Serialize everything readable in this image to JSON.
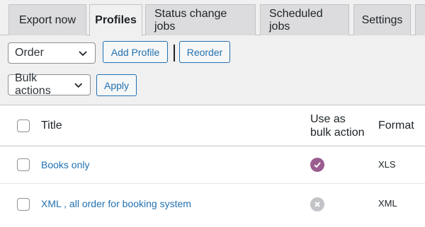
{
  "tabs": [
    {
      "label": "Export now",
      "active": false
    },
    {
      "label": "Profiles",
      "active": true
    },
    {
      "label": "Status change jobs",
      "active": false
    },
    {
      "label": "Scheduled jobs",
      "active": false
    },
    {
      "label": "Settings",
      "active": false
    }
  ],
  "toolbar": {
    "order_select_value": "Order",
    "add_profile_label": "Add Profile",
    "reorder_label": "Reorder",
    "bulk_select_value": "Bulk actions",
    "apply_label": "Apply"
  },
  "table": {
    "headers": {
      "title": "Title",
      "bulk_line1": "Use as",
      "bulk_line2": "bulk action",
      "format": "Format"
    },
    "rows": [
      {
        "title": "Books only",
        "bulk_action": true,
        "format": "XLS"
      },
      {
        "title": "XML , all order for booking system",
        "bulk_action": false,
        "format": "XML"
      }
    ]
  },
  "colors": {
    "link": "#2271b1",
    "check_enabled": "#9b5c8f",
    "check_disabled": "#c3c4c7"
  },
  "icons": {
    "enabled": "check-circle-icon",
    "disabled": "x-circle-icon"
  }
}
